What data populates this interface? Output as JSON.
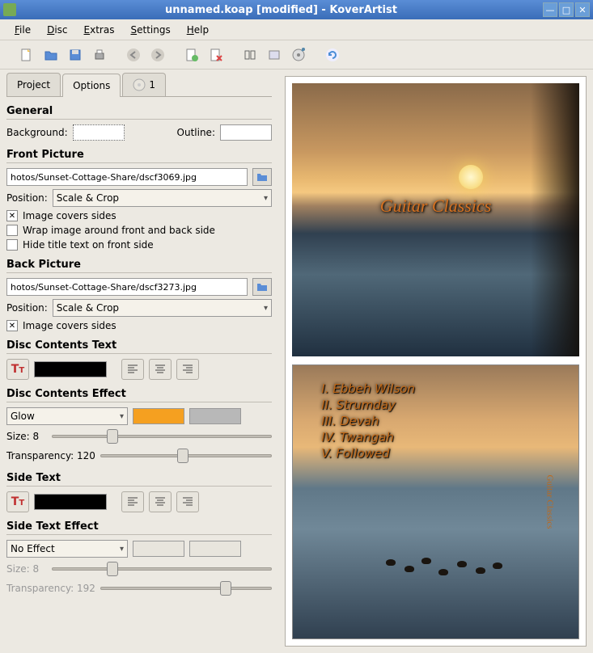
{
  "window": {
    "title": "unnamed.koap [modified] - KoverArtist"
  },
  "menu": {
    "file": "File",
    "disc": "Disc",
    "extras": "Extras",
    "settings": "Settings",
    "help": "Help"
  },
  "tabs": {
    "project": "Project",
    "options": "Options",
    "disc1": "1"
  },
  "general": {
    "header": "General",
    "background_label": "Background:",
    "outline_label": "Outline:"
  },
  "front_picture": {
    "header": "Front Picture",
    "path": "hotos/Sunset-Cottage-Share/dscf3069.jpg",
    "position_label": "Position:",
    "position_value": "Scale & Crop",
    "covers_sides": "Image covers sides",
    "covers_sides_checked": true,
    "wrap": "Wrap image around front and back side",
    "wrap_checked": false,
    "hide_title": "Hide title text on front side",
    "hide_title_checked": false
  },
  "back_picture": {
    "header": "Back Picture",
    "path": "hotos/Sunset-Cottage-Share/dscf3273.jpg",
    "position_label": "Position:",
    "position_value": "Scale & Crop",
    "covers_sides": "Image covers sides",
    "covers_sides_checked": true
  },
  "disc_contents_text": {
    "header": "Disc Contents Text"
  },
  "disc_contents_effect": {
    "header": "Disc Contents Effect",
    "effect": "Glow",
    "size_label": "Size: 8",
    "transparency_label": "Transparency: 120"
  },
  "side_text": {
    "header": "Side Text"
  },
  "side_text_effect": {
    "header": "Side Text Effect",
    "effect": "No Effect",
    "size_label": "Size: 8",
    "transparency_label": "Transparency: 192"
  },
  "preview": {
    "front_title": "Guitar Classics",
    "side": "Guitar Classics",
    "tracks": [
      "I. Ebbeh Wilson",
      "II. Strumday",
      "III. Devah",
      "IV. Twangah",
      "V. Followed"
    ]
  }
}
